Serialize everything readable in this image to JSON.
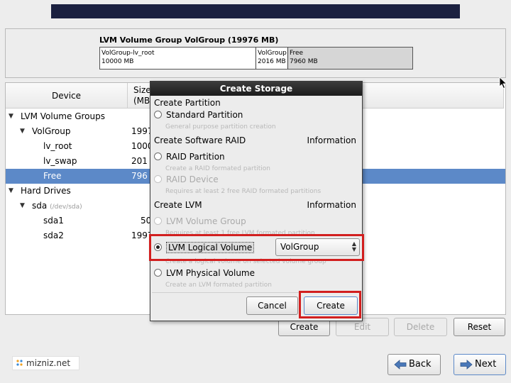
{
  "vg": {
    "title": "LVM Volume Group VolGroup (19976 MB)",
    "segments": [
      {
        "name": "VolGroup-lv_root",
        "size": "10000 MB"
      },
      {
        "name": "VolGroup",
        "size": "2016 MB"
      },
      {
        "name": "Free",
        "size": "7960 MB"
      }
    ]
  },
  "table": {
    "headers": {
      "device": "Device",
      "size_line1": "Size",
      "size_line2": "(MB"
    },
    "rows": [
      {
        "label": "LVM Volume Groups",
        "size": "",
        "path": ""
      },
      {
        "label": "VolGroup",
        "size": "1997",
        "path": ""
      },
      {
        "label": "lv_root",
        "size": "1000",
        "path": ""
      },
      {
        "label": "lv_swap",
        "size": "201",
        "path": ""
      },
      {
        "label": "Free",
        "size": "796",
        "path": ""
      },
      {
        "label": "Hard Drives",
        "size": "",
        "path": ""
      },
      {
        "label": "sda",
        "size": "",
        "path": "(/dev/sda)"
      },
      {
        "label": "sda1",
        "size": "50",
        "path": ""
      },
      {
        "label": "sda2",
        "size": "1997",
        "path": ""
      }
    ]
  },
  "buttons": {
    "create": "Create",
    "edit": "Edit",
    "delete": "Delete",
    "reset": "Reset",
    "back": "Back",
    "next": "Next"
  },
  "logo": {
    "text": "mizniz.net"
  },
  "dialog": {
    "title": "Create Storage",
    "sections": {
      "partition": "Create Partition",
      "raid": "Create Software RAID",
      "lvm": "Create LVM",
      "information": "Information"
    },
    "options": {
      "standard_partition": {
        "label": "Standard Partition",
        "desc": "General purpose partition creation"
      },
      "raid_partition": {
        "label": "RAID Partition",
        "desc": "Create a RAID formated partition"
      },
      "raid_device": {
        "label": "RAID Device",
        "desc": "Requires at least 2 free RAID formated partitions"
      },
      "lvm_volume_group": {
        "label": "LVM Volume Group",
        "desc": "Requires at least 1 free LVM formated partition"
      },
      "lvm_logical_volume": {
        "label": "LVM Logical Volume",
        "desc": "Create a logical volume on selected volume group"
      },
      "lvm_physical_volume": {
        "label": "LVM Physical Volume",
        "desc": "Create an LVM formated partition"
      }
    },
    "volume_group_select": "VolGroup",
    "cancel": "Cancel",
    "create": "Create"
  },
  "colors": {
    "highlight": "#d21f1f",
    "selection": "#5c89c8",
    "banner": "#1b2040"
  }
}
